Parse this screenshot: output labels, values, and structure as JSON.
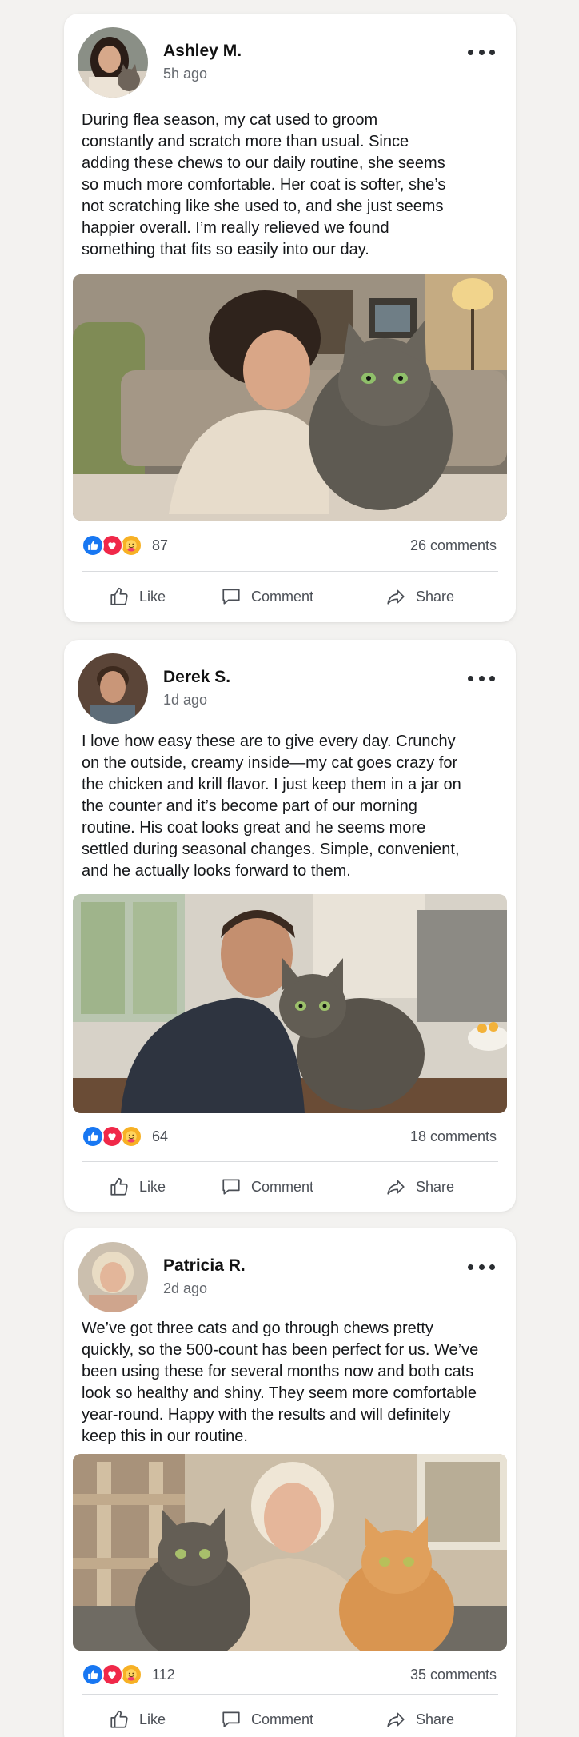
{
  "posts": [
    {
      "author": "Ashley M.",
      "time": "5h ago",
      "text": "During flea season, my cat used to groom\nconstantly and scratch more than usual. Since\nadding these chews to our daily routine, she seems\nso much more comfortable. Her coat is softer, she’s\nnot scratching like she used to, and she just seems\nhappier overall. I’m really relieved we found\nsomething that fits so easily into our day.",
      "reaction_count": "87",
      "comments": "26 comments",
      "photo_desc": "woman-with-tabby-cat-on-couch"
    },
    {
      "author": "Derek S.",
      "time": "1d ago",
      "text": "I love how easy these are to give every day. Crunchy\non the outside, creamy inside—my cat goes crazy for\nthe chicken and krill flavor. I just keep them in a jar on\nthe counter and it’s become part of our morning\nroutine. His coat looks great and he seems more\nsettled during seasonal changes. Simple, convenient,\nand he actually looks forward to them.",
      "reaction_count": "64",
      "comments": "18 comments",
      "photo_desc": "man-with-tabby-cat-in-kitchen"
    },
    {
      "author": "Patricia R.",
      "time": "2d ago",
      "text": "We’ve got three cats and go through chews pretty\nquickly, so the 500-count has been perfect for us. We’ve\nbeen using these for several months now and both cats\nlook so healthy and shiny. They seem more comfortable\nyear-round. Happy with the results and will definitely\nkeep this in our routine.",
      "reaction_count": "112",
      "comments": "35 comments",
      "photo_desc": "older-woman-with-two-cats"
    }
  ],
  "actions": {
    "like": "Like",
    "comment": "Comment",
    "share": "Share"
  },
  "icons": {
    "more": "more-horizontal-icon",
    "like": "thumbs-up-icon",
    "comment": "speech-bubble-icon",
    "share": "share-arrow-icon",
    "reactions": [
      "like-reaction-icon",
      "love-reaction-icon",
      "care-reaction-icon"
    ]
  },
  "colors": {
    "like": "#1877f2",
    "love": "#f02849",
    "care": "#f7b125",
    "background": "#f3f2f0"
  }
}
